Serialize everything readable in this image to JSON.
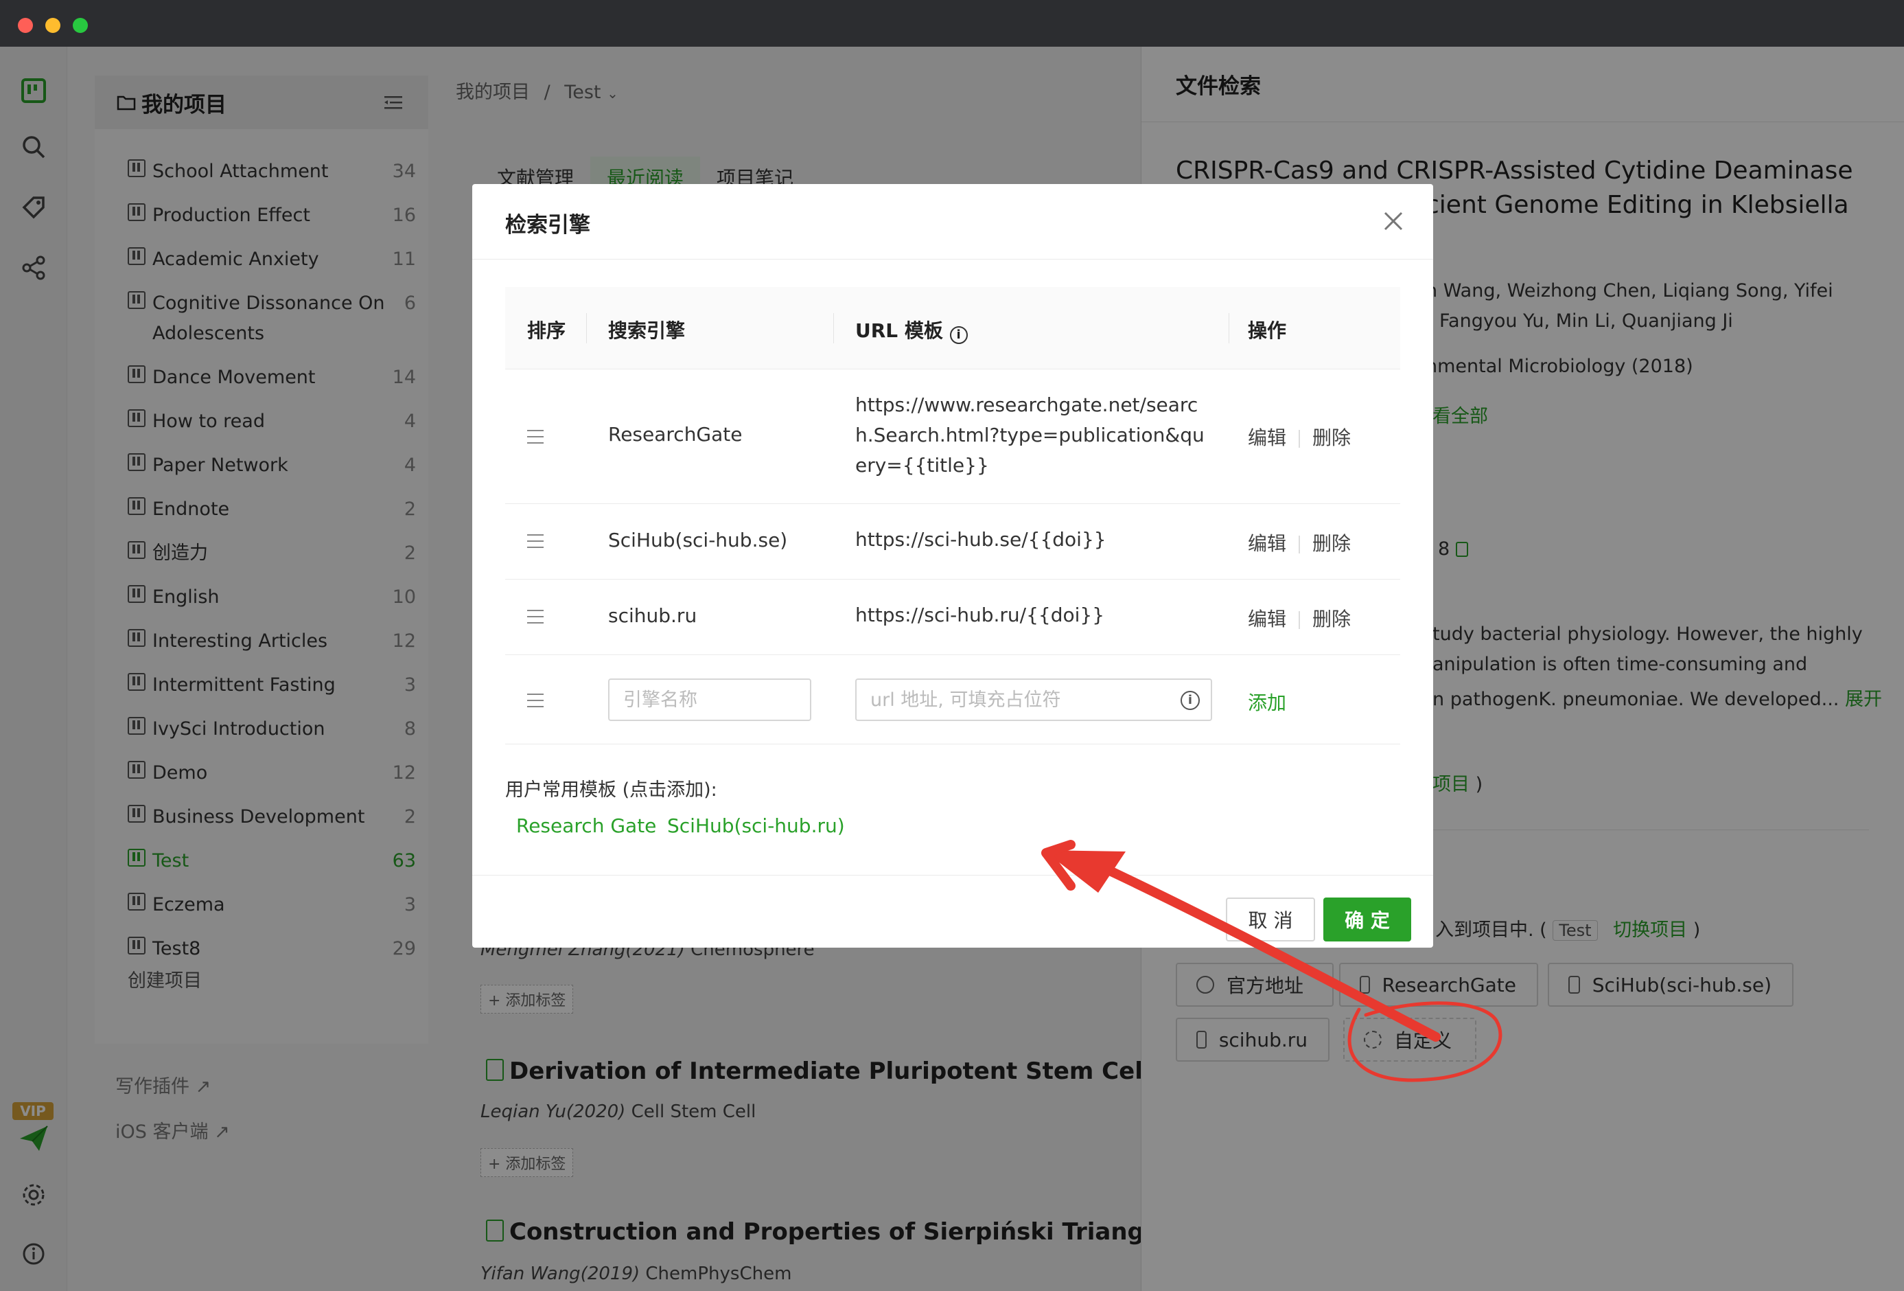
{
  "app": {
    "accent": "#2aa12a"
  },
  "breadcrumb": {
    "root": "我的项目",
    "sep": "/",
    "current": "Test"
  },
  "sidebar": {
    "header": "我的项目",
    "projects": [
      {
        "name": "School Attachment",
        "count": "34"
      },
      {
        "name": "Production Effect",
        "count": "16"
      },
      {
        "name": "Academic Anxiety",
        "count": "11"
      },
      {
        "name": "Cognitive Dissonance On Adolescents",
        "count": "6"
      },
      {
        "name": "Dance Movement",
        "count": "14"
      },
      {
        "name": "How to read",
        "count": "4"
      },
      {
        "name": "Paper Network",
        "count": "4"
      },
      {
        "name": "Endnote",
        "count": "2"
      },
      {
        "name": "创造力",
        "count": "2"
      },
      {
        "name": "English",
        "count": "10"
      },
      {
        "name": "Interesting Articles",
        "count": "12"
      },
      {
        "name": "Intermittent Fasting",
        "count": "3"
      },
      {
        "name": "IvySci Introduction",
        "count": "8"
      },
      {
        "name": "Demo",
        "count": "12"
      },
      {
        "name": "Business Development",
        "count": "2"
      },
      {
        "name": "Test",
        "count": "63"
      },
      {
        "name": "Eczema",
        "count": "3"
      },
      {
        "name": "Test8",
        "count": "29"
      }
    ],
    "create": "创建项目",
    "writing_plugin": "写作插件",
    "ios_client": "iOS 客户端",
    "vip": "VIP"
  },
  "main": {
    "tabs": [
      "文献管理",
      "最近阅读",
      "项目笔记"
    ],
    "papers": [
      {
        "meta_author": "Mengmei Zhang(2021)",
        "meta_journal": "Chemosphere",
        "tag": "+ 添加标签"
      },
      {
        "title": "Derivation of Intermediate Pluripotent Stem Cells Amer",
        "meta_author": "Leqian Yu(2020)",
        "meta_journal": "Cell Stem Cell",
        "tag": "+ 添加标签"
      },
      {
        "title": "Construction and Properties of Sierpiński Triangular Fr",
        "meta_author": "Yifan Wang(2019)",
        "meta_journal": "ChemPhysChem"
      }
    ]
  },
  "panel": {
    "title": "文件检索",
    "paper_title_l1": "CRISPR-Cas9 and CRISPR-Assisted Cytidine Deaminase",
    "paper_title_l2": "cient Genome Editing in Klebsiella",
    "authors_l1": "n Wang, Weizhong Chen, Liqiang Song, Yifei",
    "authors_l2": "Fangyou Yu, Min Li, Quanjiang Ji",
    "journal": "nmental Microbiology (2018)",
    "view_all": "看全部",
    "citation_frag": "8",
    "abstract_l1": "tudy bacterial physiology. However, the highly",
    "abstract_l2": "anipulation is often time-consuming and",
    "abstract_l3": "n pathogenK. pneumoniae. We developed...",
    "expand": "展开",
    "project_link_frag": "项目",
    "project_close": ")",
    "added_text": "入到项目中. (",
    "test_pill": "Test",
    "switch": "切换项目",
    "switch_close": ")",
    "engines": [
      "官方地址",
      "ResearchGate",
      "SciHub(sci-hub.se)",
      "scihub.ru",
      "自定义"
    ]
  },
  "modal": {
    "title": "检索引擎",
    "columns": {
      "order": "排序",
      "engine": "搜索引擎",
      "url": "URL 模板",
      "action": "操作"
    },
    "rows": [
      {
        "name": "ResearchGate",
        "url": "https://www.researchgate.net/search.Search.html?type=publication&query={{title}}",
        "edit": "编辑",
        "del": "删除"
      },
      {
        "name": "SciHub(sci-hub.se)",
        "url": "https://sci-hub.se/{{doi}}",
        "edit": "编辑",
        "del": "删除"
      },
      {
        "name": "scihub.ru",
        "url": "https://sci-hub.ru/{{doi}}",
        "edit": "编辑",
        "del": "删除"
      }
    ],
    "new_row": {
      "name_placeholder": "引擎名称",
      "url_placeholder": "url 地址, 可填充占位符",
      "add": "添加"
    },
    "templates_label": "用户常用模板 (点击添加):",
    "templates": [
      "Research Gate",
      "SciHub(sci-hub.ru)"
    ],
    "cancel": "取 消",
    "confirm": "确 定"
  }
}
